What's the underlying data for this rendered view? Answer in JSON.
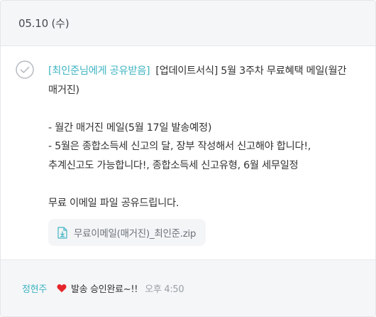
{
  "header": {
    "date": "05.10 (수)"
  },
  "message": {
    "tag": "[최인준님에게 공유받음]",
    "title": "[업데이트서식] 5월 3주차 무료혜택 메일(월간 매거진)",
    "line1": "- 월간 매거진 메일(5월 17일 발송예정)",
    "line2": "- 5월은 종합소득세 신고의 달, 장부 작성해서 신고해야 합니다!, 추계신고도 가능합니다!, 종합소득세 신고유형, 6월 세무일정",
    "line3": "무료 이메일 파일 공유드립니다.",
    "attachment": "무료이메일(매거진)_최인준.zip"
  },
  "footer": {
    "author": "정현주",
    "reply": "발송 승인완료~!!",
    "time": "오후 4:50"
  },
  "colors": {
    "accent": "#3fb4c2",
    "heart": "#e5262d",
    "header_bg": "#f5f6f8"
  },
  "icons": [
    "check-circle-icon",
    "zip-file-icon",
    "heart-icon"
  ]
}
